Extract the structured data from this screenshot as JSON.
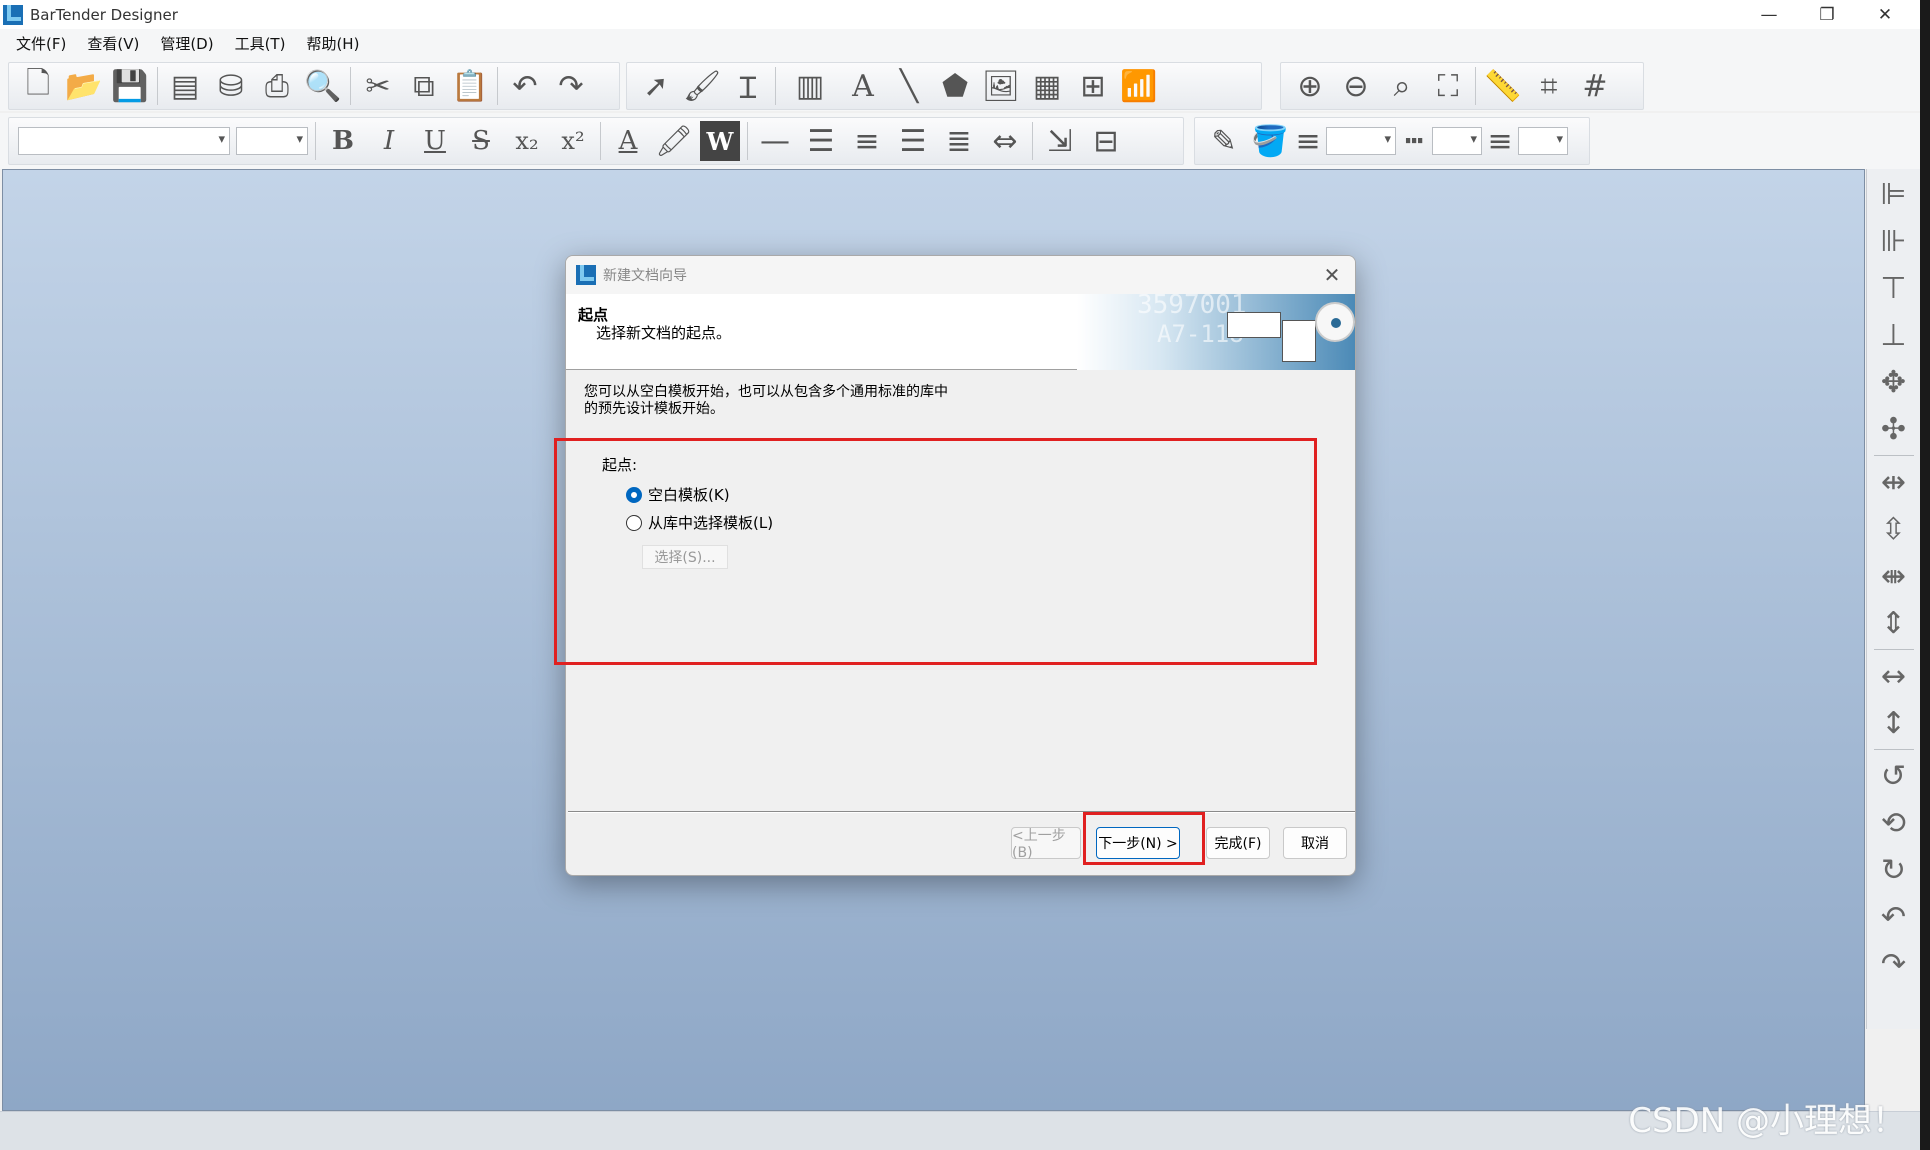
{
  "app": {
    "title": "BarTender Designer"
  },
  "window_controls": {
    "minimize": "—",
    "restore": "❐",
    "close": "✕"
  },
  "menu": [
    "文件(F)",
    "查看(V)",
    "管理(D)",
    "工具(T)",
    "帮助(H)"
  ],
  "toolbar_row1_icons": [
    "new-document-icon",
    "open-folder-icon",
    "save-icon",
    "page-setup-icon",
    "database-icon",
    "print-icon",
    "print-preview-icon",
    "cut-icon",
    "copy-icon",
    "paste-icon",
    "undo-icon",
    "redo-icon",
    "pointer-icon",
    "brush-icon",
    "text-cursor-icon",
    "barcode-icon",
    "text-tool-icon",
    "line-icon",
    "shape-icon",
    "picture-icon",
    "table-icon",
    "grid-icon",
    "rfid-icon",
    "zoom-in-icon",
    "zoom-out-icon",
    "zoom-selection-icon",
    "fit-page-icon",
    "ruler-icon",
    "crop-marks-icon",
    "grid-lines-icon"
  ],
  "toolbar_row2": {
    "bold": "B",
    "italic": "I",
    "underline": "U",
    "strike": "S",
    "subscript": "x₂",
    "superscript": "x²",
    "font_color": "A",
    "wordart": "W"
  },
  "watermark": "CSDN @小理想！",
  "dialog": {
    "title": "新建文档向导",
    "close": "✕",
    "header_title": "起点",
    "header_subtitle": "选择新文档的起点。",
    "banner_text1": "3597001",
    "banner_text2": "A7-118",
    "description_line1": "您可以从空白模板开始，也可以从包含多个通用标准的库中",
    "description_line2": "的预先设计模板开始。",
    "group_label": "起点:",
    "options": [
      {
        "label": "空白模板(K)",
        "checked": true
      },
      {
        "label": "从库中选择模板(L)",
        "checked": false
      }
    ],
    "select_button": "选择(S)...",
    "buttons": {
      "back": "<上一步(B)",
      "next": "下一步(N) >",
      "finish": "完成(F)",
      "cancel": "取消"
    }
  },
  "colors": {
    "highlight": "#e02020",
    "accent": "#0067c0",
    "workspace_top": "#c3d4e8",
    "workspace_bottom": "#8ea7c6"
  }
}
